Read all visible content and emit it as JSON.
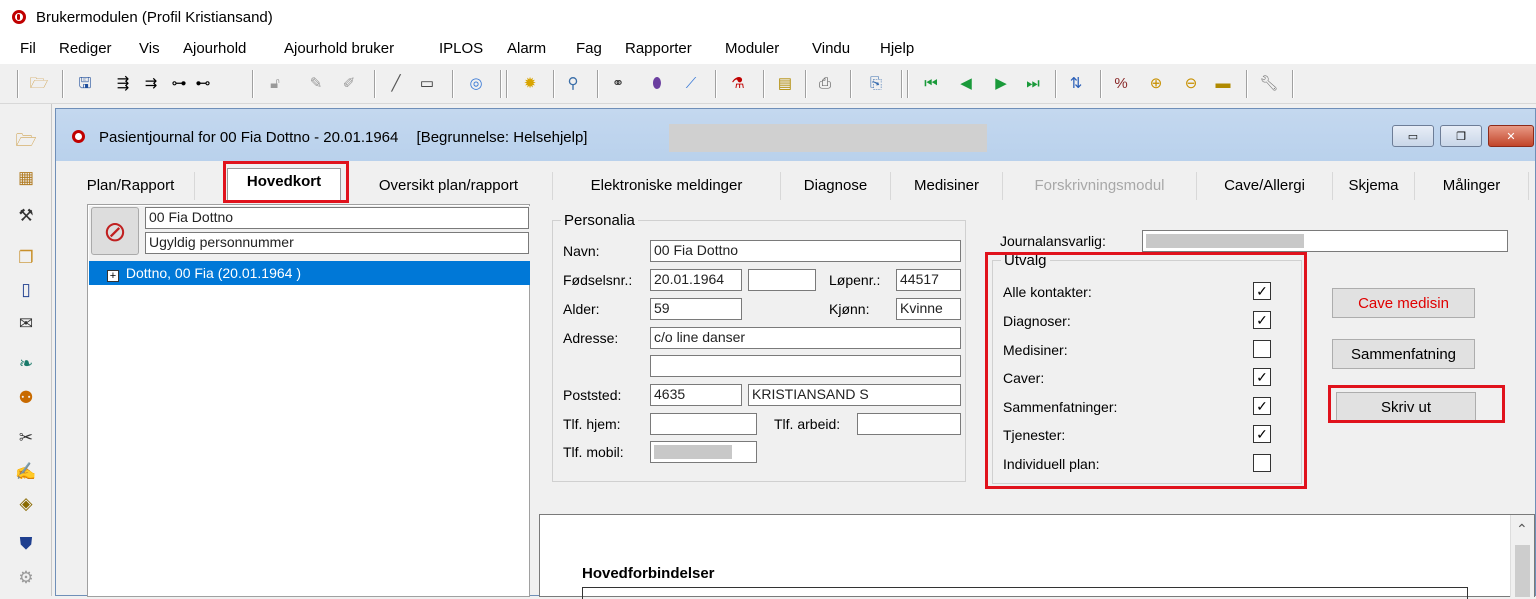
{
  "app": {
    "title": "Brukermodulen (Profil Kristiansand)"
  },
  "menu": [
    "Fil",
    "Rediger",
    "Vis",
    "Ajourhold",
    "Ajourhold bruker",
    "IPLOS",
    "Alarm",
    "Fag",
    "Rapporter",
    "Moduler",
    "Vindu",
    "Hjelp"
  ],
  "toolbar_icons": [
    "folder-open-icon",
    "save-icon",
    "tree-expand-icon",
    "tree-indent-icon",
    "tree-node-icon",
    "tree-branch-icon",
    "unlock-icon",
    "pen-icon",
    "pens-icon",
    "pencil-icon",
    "card-icon",
    "cd-refresh-icon",
    "light-icon",
    "search-icon",
    "binoculars-icon",
    "capsule-icon",
    "syringe-icon",
    "microscope-icon",
    "notes-icon",
    "print-icon",
    "fax-icon",
    "first-icon",
    "prev-icon",
    "next-icon",
    "last-icon",
    "sort-icon",
    "percent-icon",
    "zoom-in-icon",
    "zoom-out-icon",
    "ruler-icon",
    "wrench-icon"
  ],
  "child_window": {
    "title": "Pasientjournal for 00 Fia Dottno - 20.01.1964",
    "reason": "[Begrunnelse: Helsehjelp]",
    "minimize": "▭",
    "restore": "❐",
    "close": "✕"
  },
  "tabs": [
    {
      "label": "Plan/Rapport",
      "state": "normal"
    },
    {
      "label": "Hovedkort",
      "state": "active"
    },
    {
      "label": "Oversikt plan/rapport",
      "state": "normal"
    },
    {
      "label": "Elektroniske meldinger",
      "state": "normal"
    },
    {
      "label": "Diagnose",
      "state": "normal"
    },
    {
      "label": "Medisiner",
      "state": "normal"
    },
    {
      "label": "Forskrivningsmodul",
      "state": "disabled"
    },
    {
      "label": "Cave/Allergi",
      "state": "normal"
    },
    {
      "label": "Skjema",
      "state": "normal"
    },
    {
      "label": "Målinger",
      "state": "normal"
    }
  ],
  "patient": {
    "name_header": "00 Fia Dottno",
    "pnr_status": "Ugyldig personnummer",
    "tree_item": "Dottno, 00 Fia (20.01.1964 )",
    "tree_expander": "+"
  },
  "personalia": {
    "legend": "Personalia",
    "navn_label": "Navn:",
    "navn": "00 Fia Dottno",
    "fodselsnr_label": "Fødselsnr.:",
    "fodselsnr": "20.01.1964",
    "fodselsnr2": "",
    "lopenr_label": "Løpenr.:",
    "lopenr": "44517",
    "alder_label": "Alder:",
    "alder": "59",
    "kjonn_label": "Kjønn:",
    "kjonn": "Kvinne",
    "adresse_label": "Adresse:",
    "adresse1": "c/o line danser",
    "adresse2": "",
    "poststed_label": "Poststed:",
    "postnr": "4635",
    "poststed": "KRISTIANSAND S",
    "tlf_hjem_label": "Tlf. hjem:",
    "tlf_hjem": "",
    "tlf_arbeid_label": "Tlf. arbeid:",
    "tlf_arbeid": "",
    "tlf_mobil_label": "Tlf. mobil:"
  },
  "journal": {
    "label": "Journalansvarlig:"
  },
  "utvalg": {
    "legend": "Utvalg",
    "items": [
      {
        "label": "Alle kontakter:",
        "checked": true
      },
      {
        "label": "Diagnoser:",
        "checked": true
      },
      {
        "label": "Medisiner:",
        "checked": false
      },
      {
        "label": "Caver:",
        "checked": true
      },
      {
        "label": "Sammenfatninger:",
        "checked": true
      },
      {
        "label": "Tjenester:",
        "checked": true
      },
      {
        "label": "Individuell plan:",
        "checked": false
      }
    ]
  },
  "buttons": {
    "cave_medisin": "Cave medisin",
    "sammenfatning": "Sammenfatning",
    "skriv_ut": "Skriv ut"
  },
  "report": {
    "heading": "Hovedforbindelser",
    "scroll_up": "⌃"
  },
  "colors": {
    "highlight": "#e0121c",
    "selection": "#0078d7",
    "cave_text": "#e00000"
  }
}
